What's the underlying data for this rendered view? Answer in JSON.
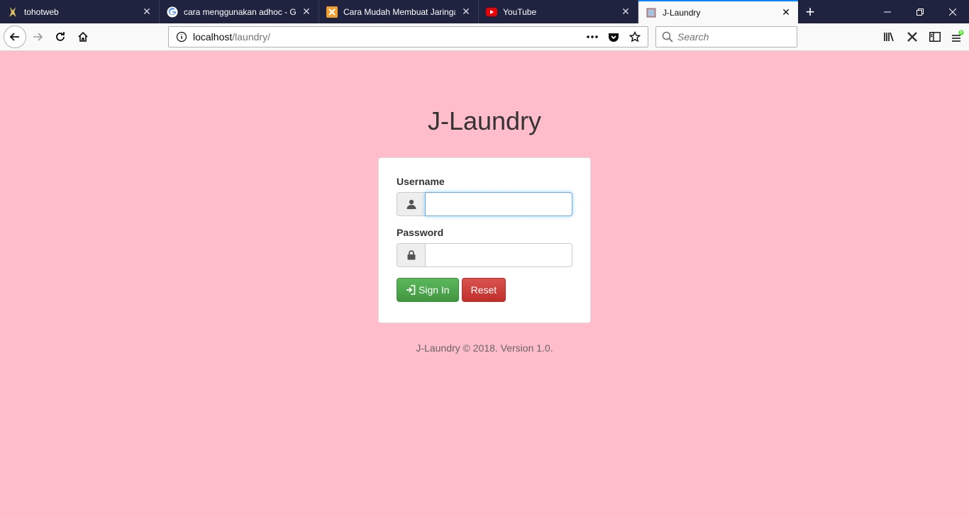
{
  "browser": {
    "tabs": [
      {
        "title": "tohotweb",
        "icon": "tohotweb-favicon",
        "active": false
      },
      {
        "title": "cara menggunakan adhoc - Go",
        "icon": "google-favicon",
        "active": false
      },
      {
        "title": "Cara Mudah Membuat Jaringan",
        "icon": "orange-x-favicon",
        "active": false
      },
      {
        "title": "YouTube",
        "icon": "youtube-favicon",
        "active": false
      },
      {
        "title": "J-Laundry",
        "icon": "page-favicon",
        "active": true
      }
    ],
    "url_host": "localhost",
    "url_path": "/laundry/",
    "search_placeholder": "Search",
    "colors": {
      "tabbar": "#202340",
      "active_tab_accent": "#0a84ff"
    }
  },
  "page": {
    "title": "J-Laundry",
    "background": "#ffbccb",
    "form": {
      "username_label": "Username",
      "username_value": "",
      "password_label": "Password",
      "password_value": "",
      "signin_label": "Sign In",
      "reset_label": "Reset"
    },
    "footer": "J-Laundry © 2018. Version 1.0."
  }
}
